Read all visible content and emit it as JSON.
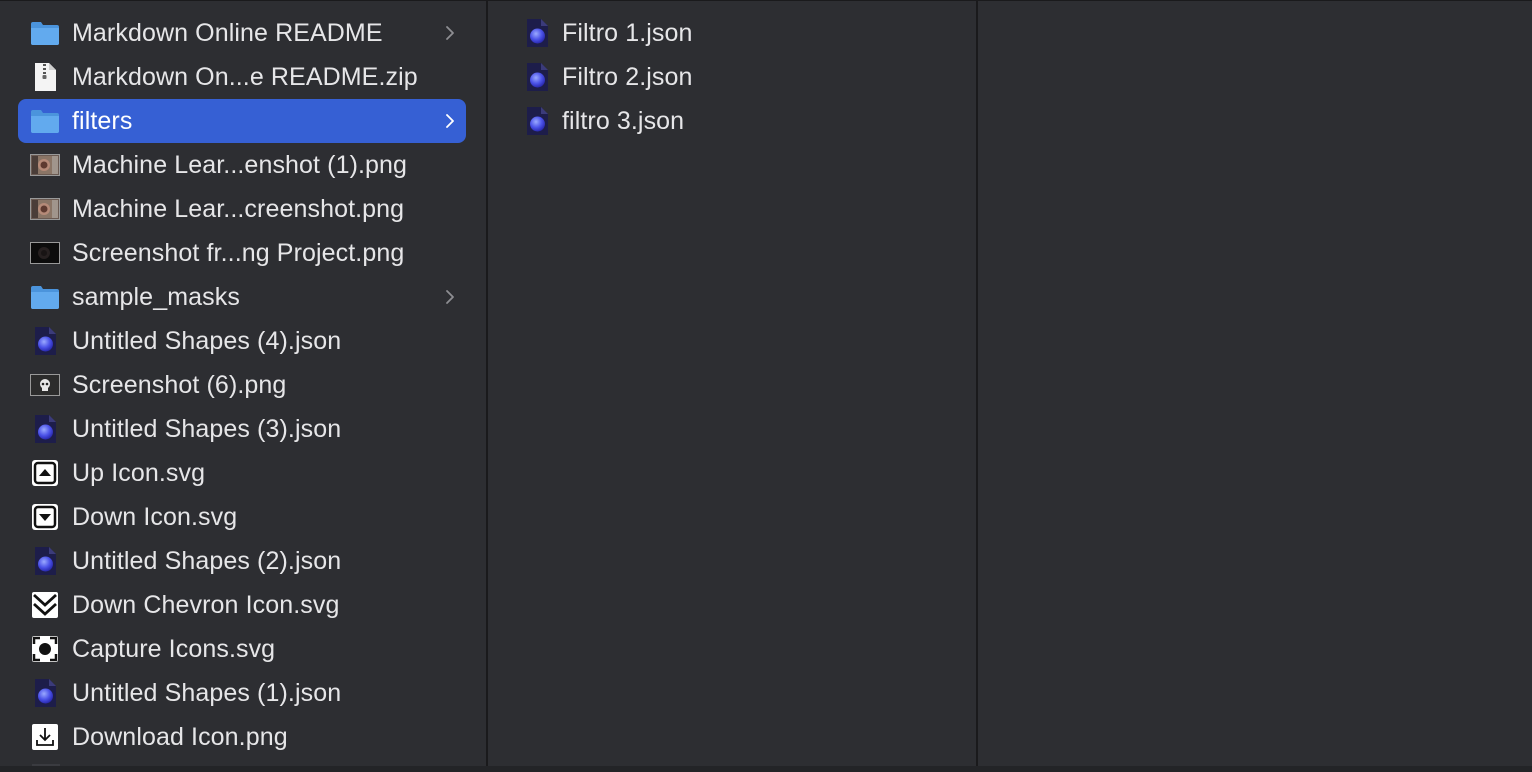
{
  "column1": {
    "items": [
      {
        "name": "Markdown Online README",
        "icon": "folder-icon",
        "folder": true,
        "selected": false
      },
      {
        "name": "Markdown On...e README.zip",
        "icon": "zip-file-icon",
        "folder": false,
        "selected": false
      },
      {
        "name": "filters",
        "icon": "folder-icon",
        "folder": true,
        "selected": true
      },
      {
        "name": "Machine Lear...enshot (1).png",
        "icon": "image-thumbnail-icon",
        "folder": false,
        "selected": false
      },
      {
        "name": "Machine Lear...creenshot.png",
        "icon": "image-thumbnail-icon",
        "folder": false,
        "selected": false
      },
      {
        "name": "Screenshot fr...ng Project.png",
        "icon": "dark-image-thumbnail-icon",
        "folder": false,
        "selected": false
      },
      {
        "name": "sample_masks",
        "icon": "folder-icon",
        "folder": true,
        "selected": false
      },
      {
        "name": "Untitled Shapes (4).json",
        "icon": "json-document-icon",
        "folder": false,
        "selected": false
      },
      {
        "name": "Screenshot (6).png",
        "icon": "skull-thumbnail-icon",
        "folder": false,
        "selected": false
      },
      {
        "name": "Untitled Shapes (3).json",
        "icon": "json-document-icon",
        "folder": false,
        "selected": false
      },
      {
        "name": "Up Icon.svg",
        "icon": "up-svg-icon",
        "folder": false,
        "selected": false
      },
      {
        "name": "Down Icon.svg",
        "icon": "down-svg-icon",
        "folder": false,
        "selected": false
      },
      {
        "name": "Untitled Shapes (2).json",
        "icon": "json-document-icon",
        "folder": false,
        "selected": false
      },
      {
        "name": "Down Chevron Icon.svg",
        "icon": "down-chevron-svg-icon",
        "folder": false,
        "selected": false
      },
      {
        "name": "Capture Icons.svg",
        "icon": "capture-svg-icon",
        "folder": false,
        "selected": false
      },
      {
        "name": "Untitled Shapes (1).json",
        "icon": "json-document-icon",
        "folder": false,
        "selected": false
      },
      {
        "name": "Download Icon.png",
        "icon": "download-png-icon",
        "folder": false,
        "selected": false
      }
    ]
  },
  "column2": {
    "items": [
      {
        "name": "Filtro 1.json",
        "icon": "json-document-icon"
      },
      {
        "name": "Filtro 2.json",
        "icon": "json-document-icon"
      },
      {
        "name": "filtro 3.json",
        "icon": "json-document-icon"
      }
    ]
  },
  "colors": {
    "background": "#2d2e32",
    "selection": "#3660d4",
    "text": "#e6e6e8",
    "folder": "#5aa5ec"
  }
}
